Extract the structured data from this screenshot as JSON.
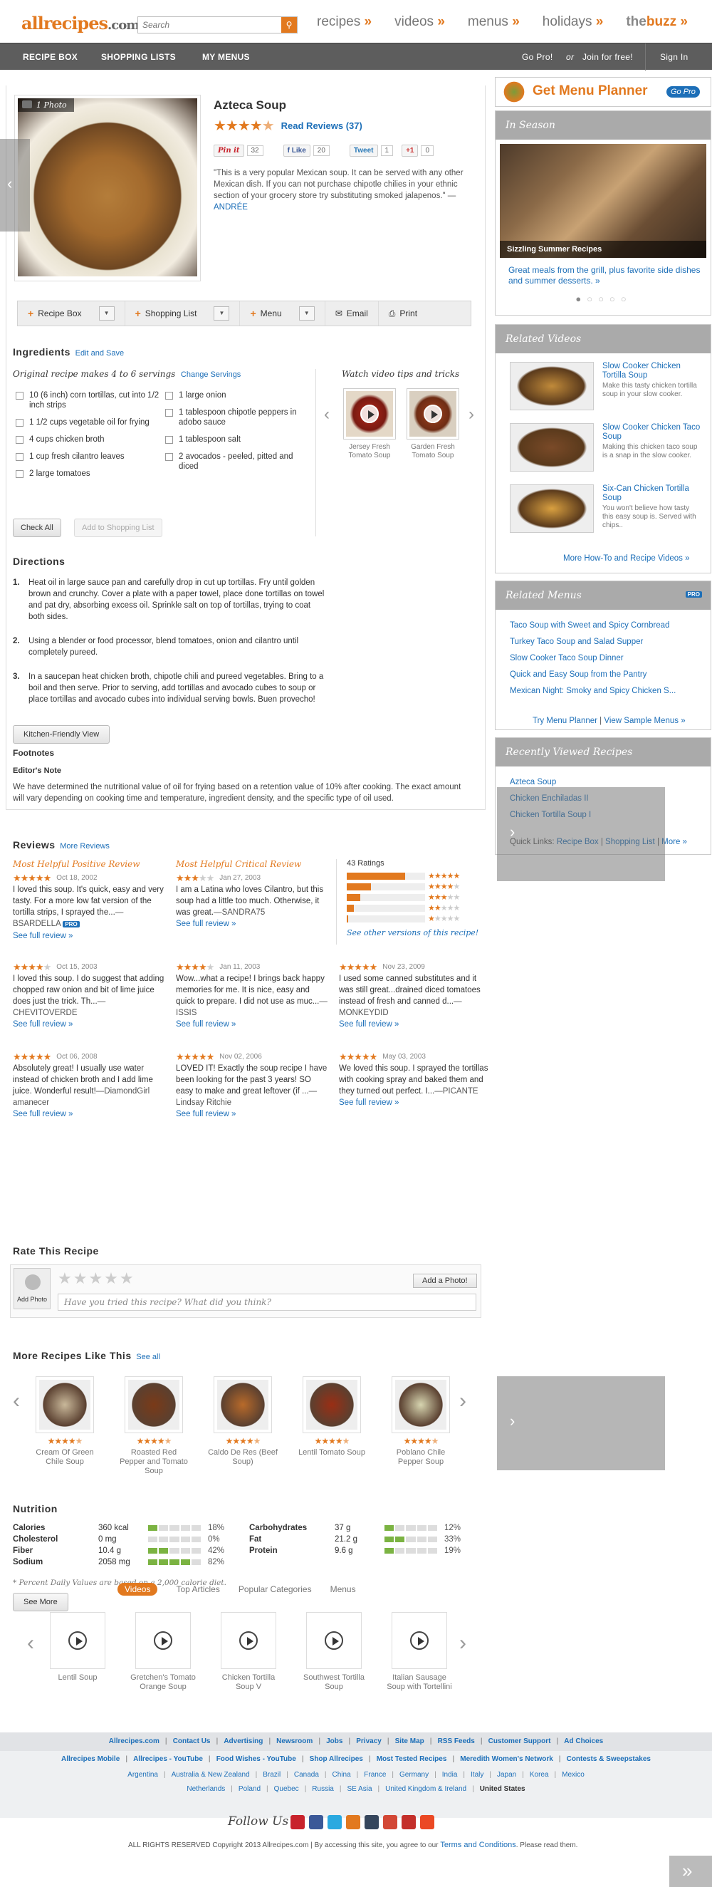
{
  "header": {
    "logo_main": "allrecipes",
    "logo_suffix": ".com",
    "search_placeholder": "Search",
    "nav": [
      "recipes",
      "videos",
      "menus",
      "holidays"
    ],
    "nav_arrow": "»",
    "buzz_the": "the",
    "buzz_word": "buzz",
    "buzz_arrow": "»"
  },
  "navbar": {
    "left": [
      "RECIPE BOX",
      "SHOPPING LISTS",
      "MY MENUS"
    ],
    "gopro": "Go Pro!",
    "or": "or",
    "join": "Join for free!",
    "signin": "Sign In"
  },
  "recipe": {
    "photo_label": "1 Photo",
    "title": "Azteca Soup",
    "rating": 4.5,
    "read_reviews": "Read Reviews (37)",
    "social": {
      "pinit": "Pin it",
      "pin_count": "32",
      "like": "Like",
      "like_count": "20",
      "tweet": "Tweet",
      "tweet_count": "1",
      "gplus": "+1",
      "gplus_count": "0"
    },
    "quote": "\"This is a very popular Mexican soup. It can be served with any other Mexican dish. If you can not purchase chipotle chilies in your ethnic section of your grocery store try substituting smoked jalapenos.\"",
    "quote_dash": " — ",
    "quote_author": "ANDRÉE"
  },
  "toolbar": {
    "recipe_box": "Recipe Box",
    "shopping_list": "Shopping List",
    "menu": "Menu",
    "email": "Email",
    "print": "Print"
  },
  "ingredients": {
    "heading": "Ingredients",
    "edit_link": "Edit and Save",
    "original": "Original recipe makes 4 to 6 servings",
    "change": "Change Servings",
    "col1": [
      "10 (6 inch) corn tortillas, cut into 1/2 inch strips",
      "1 1/2 cups vegetable oil for frying",
      "4 cups chicken broth",
      "1 cup fresh cilantro leaves",
      "2 large tomatoes"
    ],
    "col2": [
      "1 large onion",
      "1 tablespoon chipotle peppers in adobo sauce",
      "1 tablespoon salt",
      "2 avocados - peeled, pitted and diced"
    ],
    "check_all": "Check All",
    "add_to_list": "Add to Shopping List",
    "video_tips": "Watch video tips and tricks",
    "videos": [
      "Jersey Fresh Tomato Soup",
      "Garden Fresh Tomato Soup"
    ]
  },
  "directions": {
    "heading": "Directions",
    "steps": [
      "Heat oil in large sauce pan and carefully drop in cut up tortillas. Fry until golden brown and crunchy. Cover a plate with a paper towel, place done tortillas on towel and pat dry, absorbing excess oil. Sprinkle salt on top of tortillas, trying to coat both sides.",
      "Using a blender or food processor, blend tomatoes, onion and cilantro until completely pureed.",
      "In a saucepan heat chicken broth, chipotle chili and pureed vegetables. Bring to a boil and then serve. Prior to serving, add tortillas and avocado cubes to soup or place tortillas and avocado cubes into individual serving bowls. Buen provecho!"
    ],
    "kitchen_view": "Kitchen-Friendly View",
    "footnotes": "Footnotes",
    "editor_note": "Editor's Note",
    "editor_text": "We have determined the nutritional value of oil for frying based on a retention value of 10% after cooking. The exact amount will vary depending on cooking time and temperature, ingredient density, and the specific type of oil used."
  },
  "reviews": {
    "heading": "Reviews",
    "more": "More Reviews",
    "positive_label": "Most Helpful Positive Review",
    "critical_label": "Most Helpful Critical Review",
    "see_full": "See full review »",
    "ratings_count": "43 Ratings",
    "rating_dist": [
      0.34,
      0.14,
      0.08,
      0.04,
      0.01
    ],
    "see_other": "See other versions of this recipe!",
    "items": [
      {
        "stars": 5,
        "date": "Oct 18, 2002",
        "text": "I loved this soup. It's quick, easy and very tasty. For a more low fat version of the tortilla strips, I sprayed the...",
        "by": "—BSARDELLA",
        "pro": "PRO"
      },
      {
        "stars": 3,
        "date": "Jan 27, 2003",
        "text": "I am a Latina who loves Cilantro, but this soup had a little too much. Otherwise, it was great.",
        "by": "—SANDRA75"
      },
      {
        "stars": 4,
        "date": "Oct 15, 2003",
        "text": "I loved this soup. I do suggest that adding chopped raw onion and bit of lime juice does just the trick. Th...",
        "by": "—CHEVITOVERDE"
      },
      {
        "stars": 4,
        "date": "Jan 11, 2003",
        "text": "Wow...what a recipe! I brings back happy memories for me. It is nice, easy and quick to prepare. I did not use as muc...",
        "by": "—ISSIS"
      },
      {
        "stars": 5,
        "date": "Nov 23, 2009",
        "text": "I used some canned substitutes and it was still great...drained diced tomatoes instead of fresh and canned d...",
        "by": "—MONKEYDID"
      },
      {
        "stars": 5,
        "date": "Oct 06, 2008",
        "text": "Absolutely great! I usually use water instead of chicken broth and I add lime juice. Wonderful result!",
        "by": "—DiamondGirl amanecer"
      },
      {
        "stars": 5,
        "date": "Nov 02, 2006",
        "text": "LOVED IT! Exactly the soup recipe I have been looking for the past 3 years! SO easy to make and great leftover (if ...",
        "by": "—Lindsay Ritchie"
      },
      {
        "stars": 5,
        "date": "May 03, 2003",
        "text": "We loved this soup. I sprayed the tortillas with cooking spray and baked them and they turned out perfect. I...",
        "by": "—PICANTE"
      }
    ]
  },
  "rate": {
    "heading": "Rate This Recipe",
    "add_photo_label": "Add Photo",
    "add_photo_btn": "Add a Photo!",
    "placeholder": "Have you tried this recipe? What did you think?"
  },
  "more_recipes": {
    "heading": "More Recipes Like This",
    "see_all": "See all",
    "items": [
      "Cream Of Green Chile Soup",
      "Roasted Red Pepper and Tomato Soup",
      "Caldo De Res (Beef Soup)",
      "Lentil Tomato Soup",
      "Poblano Chile Pepper Soup"
    ]
  },
  "nutrition": {
    "heading": "Nutrition",
    "left": [
      {
        "name": "Calories",
        "value": "360 kcal",
        "pct": "18%",
        "fill": 0.18
      },
      {
        "name": "Cholesterol",
        "value": "0 mg",
        "pct": "0%",
        "fill": 0
      },
      {
        "name": "Fiber",
        "value": "10.4 g",
        "pct": "42%",
        "fill": 0.42
      },
      {
        "name": "Sodium",
        "value": "2058 mg",
        "pct": "82%",
        "fill": 0.82
      }
    ],
    "right": [
      {
        "name": "Carbohydrates",
        "value": "37 g",
        "pct": "12%",
        "fill": 0.12
      },
      {
        "name": "Fat",
        "value": "21.2 g",
        "pct": "33%",
        "fill": 0.33
      },
      {
        "name": "Protein",
        "value": "9.6 g",
        "pct": "19%",
        "fill": 0.19
      }
    ],
    "footnote": "* Percent Daily Values are based on a 2,000 calorie diet.",
    "see_more": "See More"
  },
  "sidebar": {
    "menu_planner": "Get Menu Planner",
    "go_pro": "Go Pro",
    "in_season": "In Season",
    "season_caption": "Sizzling Summer Recipes",
    "season_link": "Great meals from the grill, plus favorite side dishes and summer desserts. »",
    "related_videos": "Related Videos",
    "videos": [
      {
        "title": "Slow Cooker Chicken Tortilla Soup",
        "desc": "Make this tasty chicken tortilla soup in your slow cooker."
      },
      {
        "title": "Slow Cooker Chicken Taco Soup",
        "desc": "Making this chicken taco soup is a snap in the slow cooker."
      },
      {
        "title": "Six-Can Chicken Tortilla Soup",
        "desc": "You won't believe how tasty this easy soup is. Served with chips.."
      }
    ],
    "more_videos": "More How-To and Recipe Videos »",
    "related_menus": "Related Menus",
    "pro": "PRO",
    "menus": [
      "Taco Soup with Sweet and Spicy Cornbread",
      "Turkey Taco Soup and Salad Supper",
      "Slow Cooker Taco Soup Dinner",
      "Quick and Easy Soup from the Pantry",
      "Mexican Night: Smoky and Spicy Chicken S..."
    ],
    "try_menu": "Try Menu Planner",
    "view_sample": "View Sample Menus »",
    "recently": "Recently Viewed Recipes",
    "recent": [
      "Azteca Soup",
      "Chicken Enchiladas II",
      "Chicken Tortilla Soup I"
    ],
    "quick_links": "Quick Links:",
    "ql_items": [
      "Recipe Box",
      "Shopping List",
      "More »"
    ]
  },
  "footer_tabs": {
    "tabs": [
      "Videos",
      "Top Articles",
      "Popular Categories",
      "Menus"
    ],
    "videos": [
      "Lentil Soup",
      "Gretchen's Tomato Orange Soup",
      "Chicken Tortilla Soup V",
      "Southwest Tortilla Soup",
      "Italian Sausage Soup with Tortellini"
    ]
  },
  "footer": {
    "row1": [
      "Allrecipes.com",
      "Contact Us",
      "Advertising",
      "Newsroom",
      "Jobs",
      "Privacy",
      "Site Map",
      "RSS Feeds",
      "Customer Support",
      "Ad Choices"
    ],
    "row2": [
      "Allrecipes Mobile",
      "Allrecipes - YouTube",
      "Food Wishes - YouTube",
      "Shop Allrecipes",
      "Most Tested Recipes",
      "Meredith Women's Network",
      "Contests & Sweepstakes"
    ],
    "row3": [
      "Argentina",
      "Australia & New Zealand",
      "Brazil",
      "Canada",
      "China",
      "France",
      "Germany",
      "India",
      "Italy",
      "Japan",
      "Korea",
      "Mexico"
    ],
    "row4": [
      "Netherlands",
      "Poland",
      "Quebec",
      "Russia",
      "SE Asia",
      "United Kingdom & Ireland"
    ],
    "us": "United States",
    "follow": "Follow Us",
    "copyright": "ALL RIGHTS RESERVED Copyright 2013 Allrecipes.com  |  By accessing this site, you agree to our",
    "terms": "Terms and Conditions",
    "read": ". Please read them."
  },
  "colors": {
    "accent": "#e2791f",
    "link": "#1d6fb8",
    "navbar": "#5d5d5d"
  }
}
